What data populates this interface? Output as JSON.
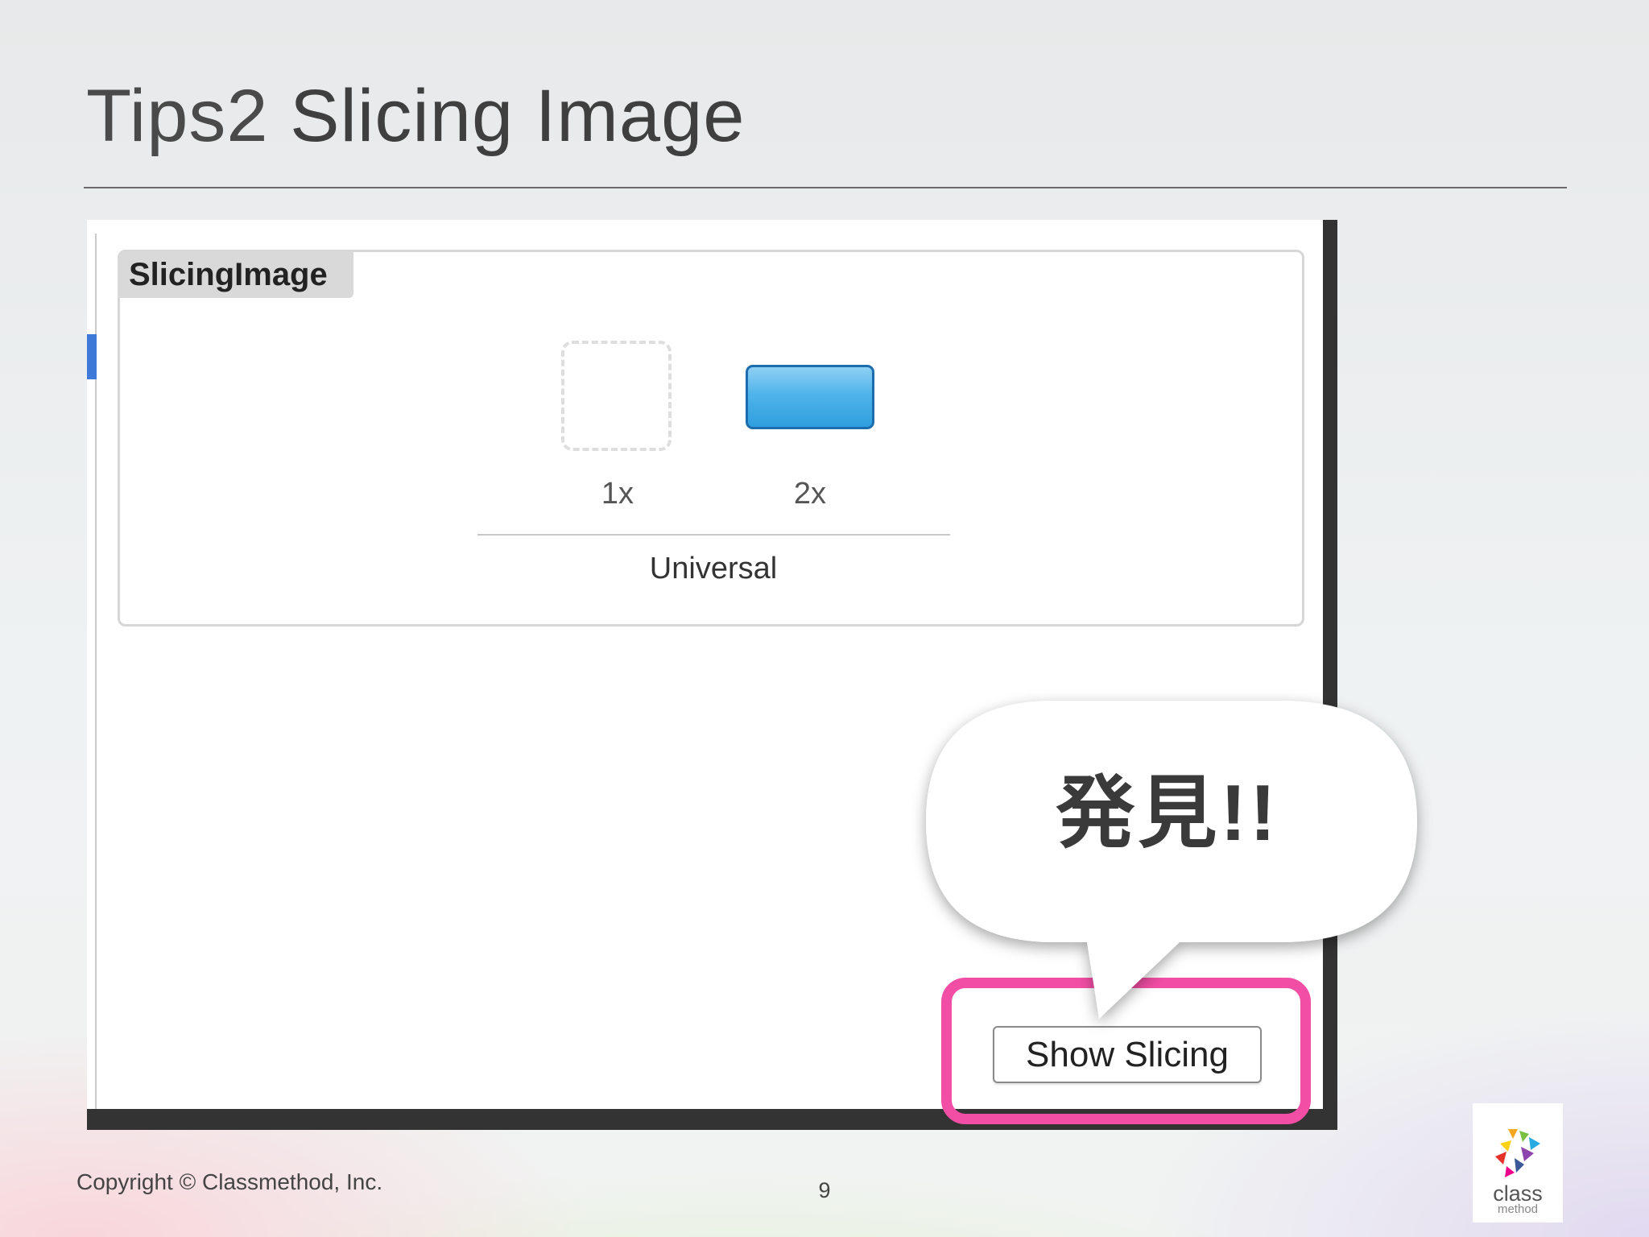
{
  "slide": {
    "title_prefix": "Tips2",
    "title_main": "Slicing Image",
    "page_number": "9",
    "copyright": "Copyright © Classmethod, Inc."
  },
  "asset_catalog": {
    "asset_name": "SlicingImage",
    "slot_1x_label": "1x",
    "slot_2x_label": "2x",
    "group_label": "Universal",
    "show_slicing_label": "Show Slicing"
  },
  "callout": {
    "text": "発見!!",
    "highlight_color": "#f24ea5"
  },
  "logo": {
    "text_main": "class",
    "text_sub": "method"
  }
}
